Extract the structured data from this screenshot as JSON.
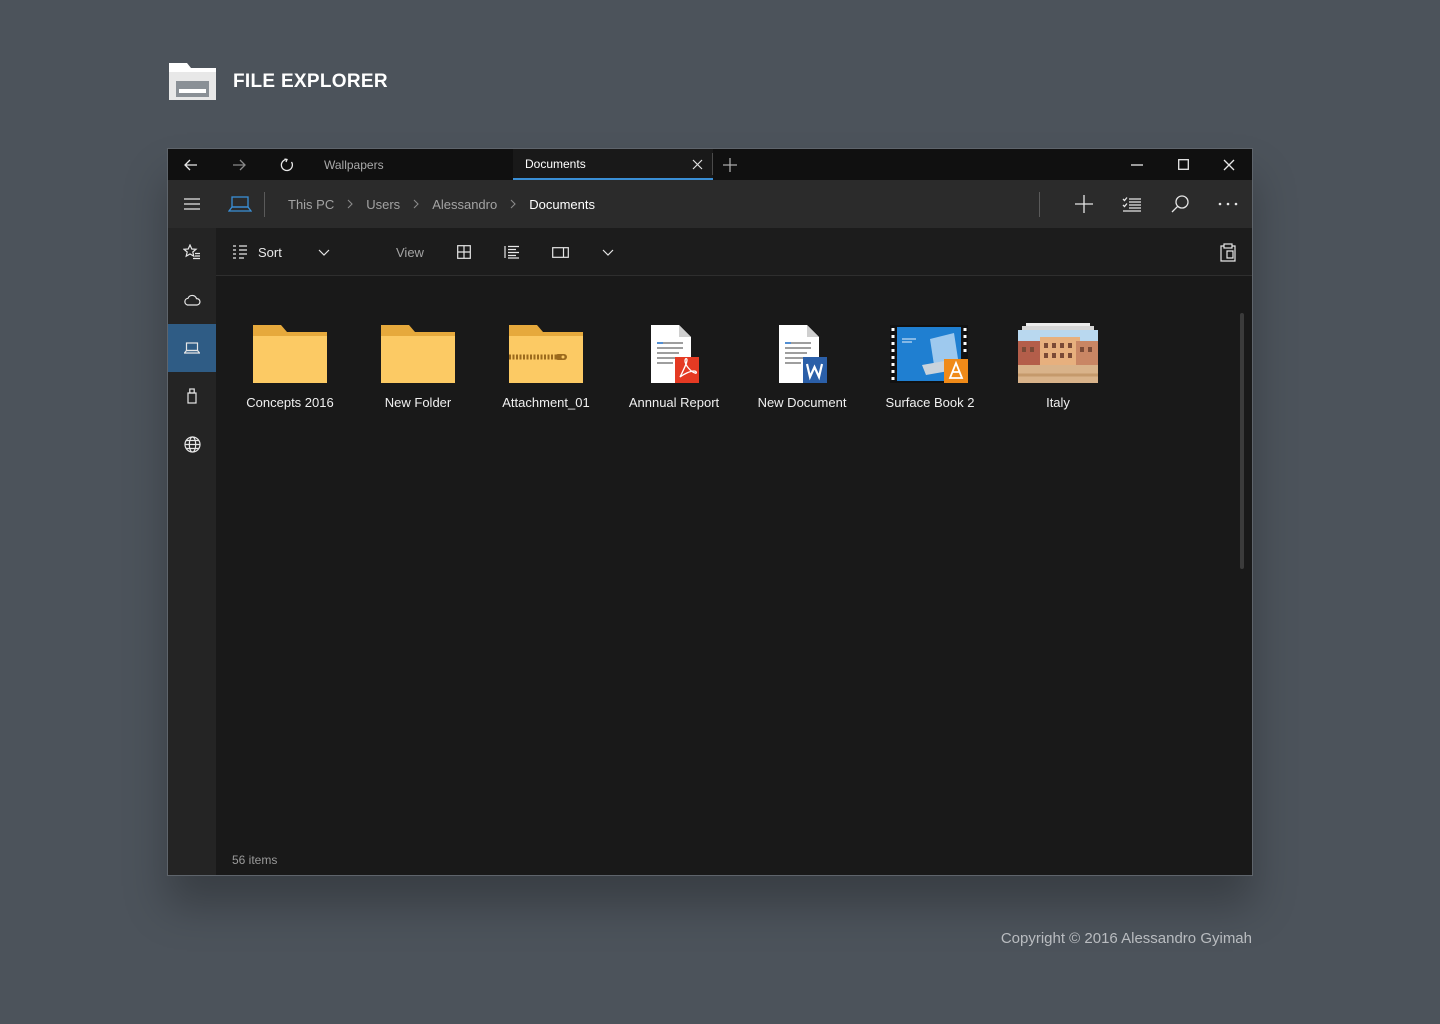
{
  "app": {
    "title": "FILE EXPLORER",
    "copyright": "Copyright © 2016 Alessandro Gyimah"
  },
  "titlebar": {
    "tabs": [
      {
        "label": "Wallpapers",
        "active": false
      },
      {
        "label": "Documents",
        "active": true
      }
    ],
    "icons": [
      "back-arrow-icon",
      "forward-arrow-icon",
      "refresh-icon",
      "close-tab-icon",
      "new-tab-icon",
      "minimize-icon",
      "maximize-icon",
      "close-window-icon"
    ]
  },
  "sidebar": {
    "items": [
      {
        "icon": "hamburger-menu-icon"
      },
      {
        "icon": "favorites-icon"
      },
      {
        "icon": "cloud-icon"
      },
      {
        "icon": "laptop-icon",
        "selected": true
      },
      {
        "icon": "usb-drive-icon"
      },
      {
        "icon": "network-globe-icon"
      }
    ]
  },
  "address": {
    "icon": "laptop-icon",
    "crumbs": [
      "This PC",
      "Users",
      "Alessandro",
      "Documents"
    ],
    "actions": [
      "add-icon",
      "select-list-icon",
      "search-icon",
      "more-icon"
    ]
  },
  "toolbar": {
    "sort_label": "Sort",
    "view_label": "View"
  },
  "files": [
    {
      "name": "Concepts 2016",
      "type": "folder"
    },
    {
      "name": "New Folder",
      "type": "folder"
    },
    {
      "name": "Attachment_01",
      "type": "zip-folder"
    },
    {
      "name": "Annnual Report",
      "type": "pdf"
    },
    {
      "name": "New Document",
      "type": "word"
    },
    {
      "name": "Surface Book 2",
      "type": "video"
    },
    {
      "name": "Italy",
      "type": "image-album"
    }
  ],
  "status": {
    "item_count": "56 items"
  },
  "colors": {
    "background": "#4c535b",
    "window": "#191919",
    "titlebar": "#101010",
    "addressbar": "#2b2b2b",
    "sidebar": "#242424",
    "selected": "#2f5c85",
    "accent": "#3a8fd6",
    "folder": "#fcca64"
  }
}
